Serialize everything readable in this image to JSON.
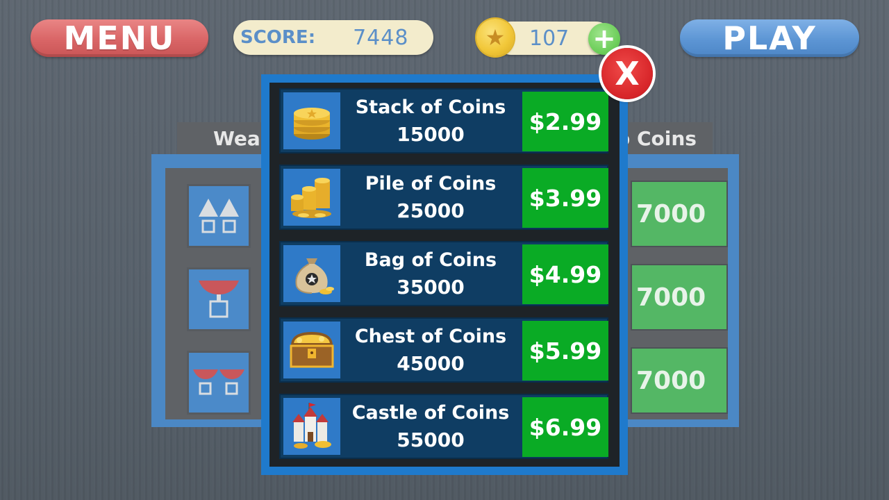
{
  "header": {
    "menu_label": "MENU",
    "play_label": "PLAY",
    "score_label": "SCORE:",
    "score_value": "7448",
    "coins_value": "107",
    "add_coins_symbol": "+",
    "star_symbol": "★"
  },
  "background_shop": {
    "tab_left_label": "Weap",
    "tab_right_label": "o Coins",
    "prices": [
      "7000",
      "7000",
      "7000"
    ]
  },
  "coin_store": {
    "close_label": "X",
    "offers": [
      {
        "name": "Stack of Coins",
        "amount": "15000",
        "price": "$2.99",
        "icon": "coin-stack-icon"
      },
      {
        "name": "Pile of Coins",
        "amount": "25000",
        "price": "$3.99",
        "icon": "coin-pile-icon"
      },
      {
        "name": "Bag of Coins",
        "amount": "35000",
        "price": "$4.99",
        "icon": "coin-bag-icon"
      },
      {
        "name": "Chest of Coins",
        "amount": "45000",
        "price": "$5.99",
        "icon": "treasure-chest-icon"
      },
      {
        "name": "Castle of Coins",
        "amount": "55000",
        "price": "$6.99",
        "icon": "coin-castle-icon"
      }
    ]
  },
  "colors": {
    "menu": "#d96566",
    "play": "#5c95d4",
    "modal_border": "#1f7acc",
    "row_bg": "#0f3d63",
    "buy_green": "#0aab25",
    "close_red": "#d8262a"
  }
}
